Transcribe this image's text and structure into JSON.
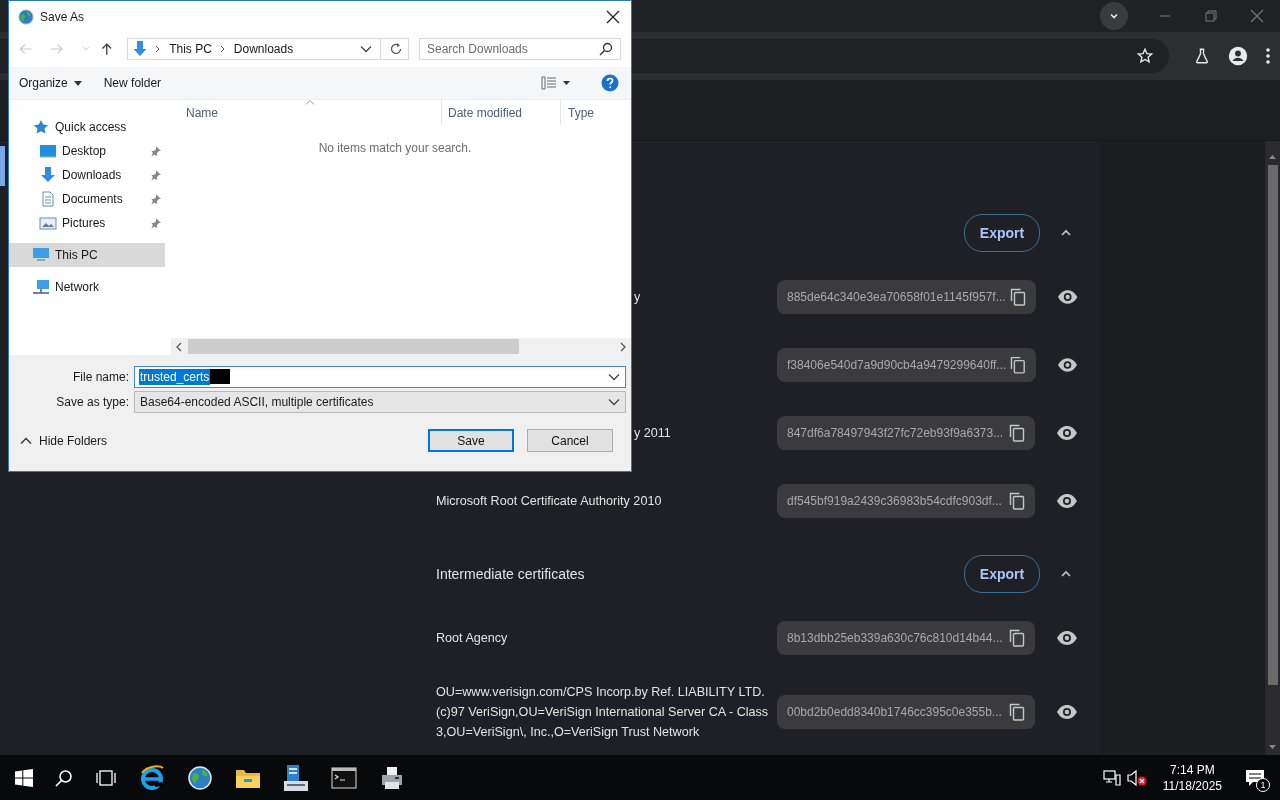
{
  "sections": [
    {
      "export_label": "Export",
      "expanded": true,
      "rows": [
        {
          "name": "y",
          "name_cut": true,
          "hash": "885de64c340e3ea70658f01e1145f957f..."
        },
        {
          "hash": "f38406e540d7a9d90cb4a9479299640ff..."
        },
        {
          "name": "y 2011",
          "name_cut": true,
          "hash": "847df6a78497943f27fc72eb93f9a6373..."
        },
        {
          "name": "Microsoft Root Certificate Authority 2010",
          "name_cut": false,
          "hash": "df545bf919a2439c36983b54cdfc903df..."
        }
      ]
    },
    {
      "title": "Intermediate certificates",
      "export_label": "Export",
      "expanded": true,
      "rows": [
        {
          "name": "Root Agency",
          "name_cut": false,
          "hash": "8b13dbb25eb339a630c76c810d14b44..."
        },
        {
          "name": "OU=www.verisign.com/CPS Incorp.by Ref. LIABILITY LTD. (c)97 VeriSign,OU=VeriSign International Server CA - Class 3,OU=VeriSign\\, Inc.,O=VeriSign Trust Network",
          "name_cut": false,
          "hash": "00bd2b0edd8340b1746cc395c0e355b..."
        }
      ]
    }
  ],
  "dialog": {
    "title": "Save As",
    "address": [
      "This PC",
      "Downloads"
    ],
    "search": {
      "placeholder": "Search Downloads"
    },
    "commands": [
      "Organize",
      "New folder"
    ],
    "nav": [
      {
        "label": "Quick access",
        "kind": "star",
        "selected": false,
        "children": [
          {
            "label": "Desktop",
            "kind": "desktop",
            "pinned": true,
            "selected": false
          },
          {
            "label": "Downloads",
            "kind": "download",
            "pinned": true,
            "selected": false
          },
          {
            "label": "Documents",
            "kind": "document",
            "pinned": true,
            "selected": false
          },
          {
            "label": "Pictures",
            "kind": "picture",
            "pinned": true,
            "selected": false
          }
        ]
      },
      {
        "label": "This PC",
        "kind": "pc",
        "selected": true
      },
      {
        "label": "Network",
        "kind": "network",
        "selected": false
      }
    ],
    "columns": [
      "Name",
      "Date modified",
      "Type"
    ],
    "empty_message": "No items match your search.",
    "file_name": {
      "label": "File name:",
      "value": "trusted_certs",
      "selected": true
    },
    "save_as_type": {
      "label": "Save as type:",
      "value": "Base64-encoded ASCII, multiple certificates"
    },
    "hide_folders": "Hide Folders",
    "buttons": [
      "Save",
      "Cancel"
    ]
  },
  "taskbar": {
    "time": "7:14 PM",
    "date": "11/18/2025",
    "notifications": "1"
  }
}
